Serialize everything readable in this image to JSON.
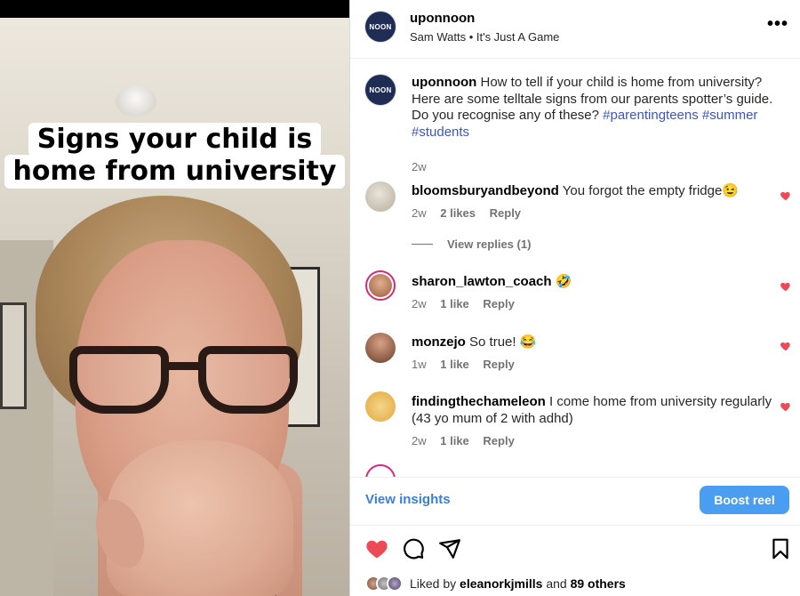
{
  "video": {
    "caption_line1": "Signs your child is",
    "caption_line2": "home from university"
  },
  "header": {
    "username": "uponnoon",
    "audio": "Sam Watts • It's Just A Game",
    "logo_text": "NOON",
    "more_icon": "more-horizontal-icon"
  },
  "post": {
    "username": "uponnoon",
    "caption": "How to tell if your child is home from university? Here are some telltale signs from our parents spotter’s guide. Do you recognise any of these?",
    "tags": [
      "#parentingteens",
      "#summer",
      "#students"
    ],
    "time": "2w"
  },
  "comments": [
    {
      "username": "bloomsburyandbeyond",
      "text": "You forgot the empty fridge😉",
      "time": "2w",
      "likes": "2 likes",
      "reply": "Reply",
      "view_replies": "View replies (1)"
    },
    {
      "username": "sharon_lawton_coach",
      "text": "🤣",
      "time": "2w",
      "likes": "1 like",
      "reply": "Reply"
    },
    {
      "username": "monzejo",
      "text": "So true! 😂",
      "time": "1w",
      "likes": "1 like",
      "reply": "Reply"
    },
    {
      "username": "findingthechameleon",
      "text": "I come home from university regularly (43 yo mum of 2 with adhd)",
      "time": "2w",
      "likes": "1 like",
      "reply": "Reply"
    }
  ],
  "footer": {
    "view_insights": "View insights",
    "boost_reel": "Boost reel",
    "liked_by_prefix": "Liked by",
    "liked_by_user": "eleanorkjmills",
    "liked_by_and": "and",
    "liked_by_others": "89 others"
  },
  "colors": {
    "like_red": "#ed4956",
    "link_blue": "#3a56c8",
    "boost_blue": "#4a9ef2",
    "logo_navy": "#1f2d55"
  }
}
